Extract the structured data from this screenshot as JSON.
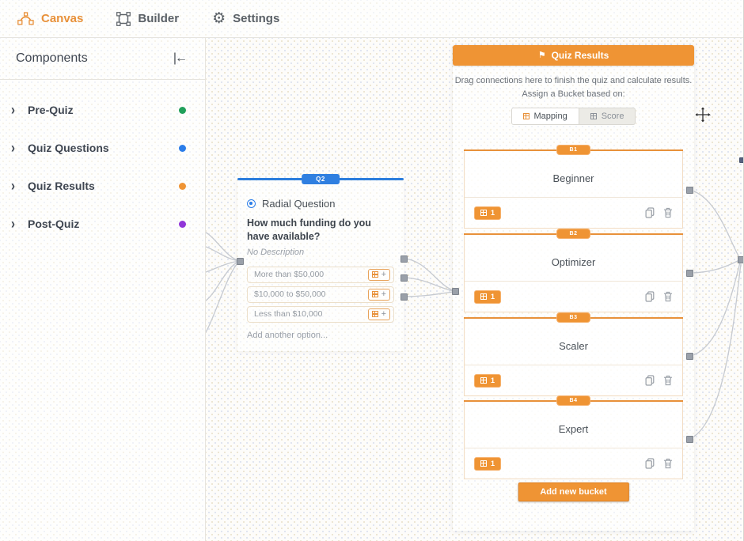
{
  "colors": {
    "accent_orange": "#ef9434",
    "accent_blue": "#2f7fe0",
    "pre_quiz_green": "#21a05a",
    "questions_blue": "#2b7de9",
    "results_orange": "#ef9434",
    "post_quiz_purple": "#9137d8"
  },
  "topnav": {
    "items": [
      {
        "label": "Canvas",
        "active": true
      },
      {
        "label": "Builder",
        "active": false
      },
      {
        "label": "Settings",
        "active": false
      }
    ]
  },
  "sidebar": {
    "title": "Components",
    "items": [
      {
        "label": "Pre-Quiz"
      },
      {
        "label": "Quiz Questions"
      },
      {
        "label": "Quiz Results"
      },
      {
        "label": "Post-Quiz"
      }
    ]
  },
  "question_node": {
    "badge": "Q2",
    "type_label": "Radial Question",
    "title": "How much funding do you have available?",
    "description": "No Description",
    "options": [
      {
        "label": "More than $50,000"
      },
      {
        "label": "$10,000 to $50,000"
      },
      {
        "label": "Less than $10,000"
      }
    ],
    "option_add_symbol": "+",
    "add_option_label": "Add another option..."
  },
  "results_node": {
    "header_label": "Quiz Results",
    "instruction_line1": "Drag connections here to finish the quiz and calculate results.",
    "instruction_line2": "Assign a Bucket based on:",
    "mode_tabs": [
      {
        "label": "Mapping",
        "active": true
      },
      {
        "label": "Score",
        "active": false
      }
    ],
    "buckets": [
      {
        "badge": "B1",
        "name": "Beginner",
        "count": "1"
      },
      {
        "badge": "B2",
        "name": "Optimizer",
        "count": "1"
      },
      {
        "badge": "B3",
        "name": "Scaler",
        "count": "1"
      },
      {
        "badge": "B4",
        "name": "Expert",
        "count": "1"
      }
    ],
    "add_bucket_label": "Add new bucket"
  }
}
